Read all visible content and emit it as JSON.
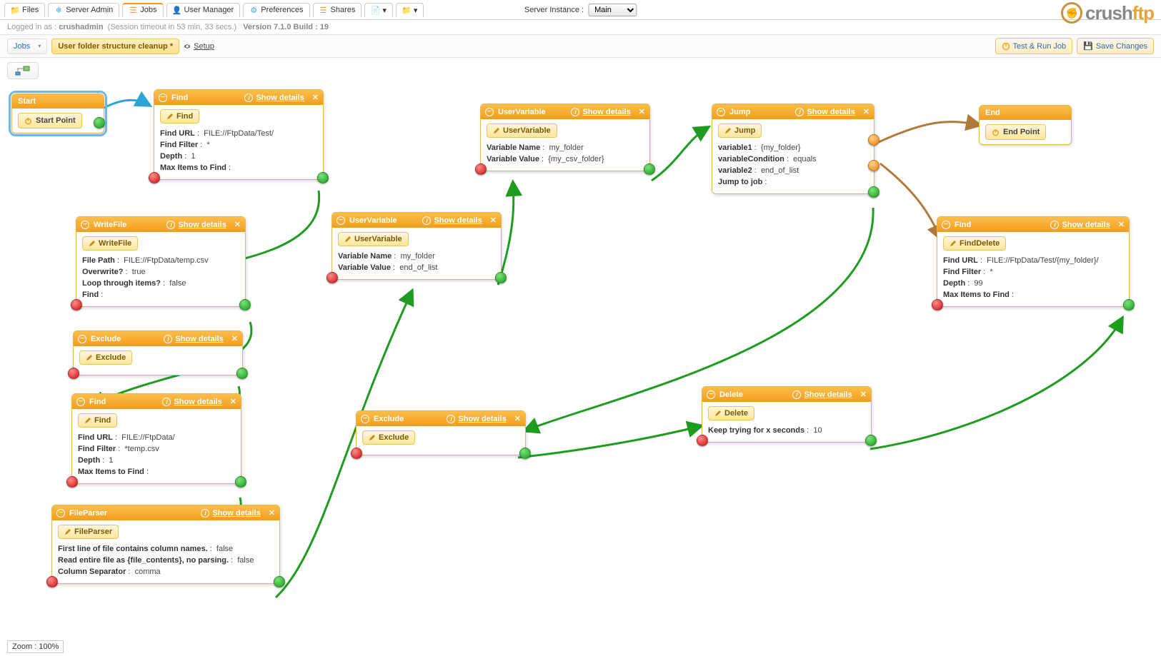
{
  "tabs": [
    {
      "label": "Files",
      "icon": "folder"
    },
    {
      "label": "Server Admin",
      "icon": "server"
    },
    {
      "label": "Jobs",
      "icon": "jobs",
      "active": true
    },
    {
      "label": "User Manager",
      "icon": "user"
    },
    {
      "label": "Preferences",
      "icon": "prefs"
    },
    {
      "label": "Shares",
      "icon": "shares"
    }
  ],
  "server_instance": {
    "label": "Server Instance :",
    "value": "Main"
  },
  "login_info": {
    "prefix": "Logged in as :",
    "user": "crushadmin",
    "session": "(Session timeout in 53 min, 33 secs.)",
    "version": "Version 7.1.0 Build : 19"
  },
  "toolbar": {
    "jobs_label": "Jobs",
    "job_name": "User folder structure cleanup *",
    "setup": "Setup",
    "test_run": "Test & Run Job",
    "save": "Save Changes"
  },
  "zoom": {
    "label": "Zoom :",
    "value": "100%"
  },
  "logo": {
    "a": "crush",
    "b": "ftp"
  },
  "nodes": {
    "start": {
      "title": "Start",
      "btn": "Start Point"
    },
    "end": {
      "title": "End",
      "btn": "End Point"
    },
    "find1": {
      "title": "Find",
      "tag": "Find",
      "show": "Show details",
      "rows": [
        [
          "Find URL",
          "FILE://FtpData/Test/"
        ],
        [
          "Find Filter",
          "*"
        ],
        [
          "Depth",
          "1"
        ],
        [
          "Max Items to Find",
          ""
        ]
      ]
    },
    "uv_top": {
      "title": "UserVariable",
      "tag": "UserVariable",
      "show": "Show details",
      "rows": [
        [
          "Variable Name",
          "my_folder"
        ],
        [
          "Variable Value",
          "{my_csv_folder}"
        ]
      ]
    },
    "jump": {
      "title": "Jump",
      "tag": "Jump",
      "show": "Show details",
      "rows": [
        [
          "variable1",
          "{my_folder}"
        ],
        [
          "variableCondition",
          "equals"
        ],
        [
          "variable2",
          "end_of_list"
        ],
        [
          "Jump to job",
          ""
        ]
      ]
    },
    "find_right": {
      "title": "Find",
      "tag": "FindDelete",
      "show": "Show details",
      "rows": [
        [
          "Find URL",
          "FILE://FtpData/Test/{my_folder}/"
        ],
        [
          "Find Filter",
          "*"
        ],
        [
          "Depth",
          "99"
        ],
        [
          "Max Items to Find",
          ""
        ]
      ]
    },
    "writefile": {
      "title": "WriteFile",
      "tag": "WriteFile",
      "show": "Show details",
      "rows": [
        [
          "File Path",
          "FILE://FtpData/temp.csv"
        ],
        [
          "Overwrite?",
          "true"
        ],
        [
          "Loop through items?",
          "false"
        ],
        [
          "Find",
          ""
        ]
      ]
    },
    "uv_mid": {
      "title": "UserVariable",
      "tag": "UserVariable",
      "show": "Show details",
      "rows": [
        [
          "Variable Name",
          "my_folder"
        ],
        [
          "Variable Value",
          "end_of_list"
        ]
      ]
    },
    "exclude1": {
      "title": "Exclude",
      "tag": "Exclude",
      "show": "Show details",
      "rows": []
    },
    "find2": {
      "title": "Find",
      "tag": "Find",
      "show": "Show details",
      "rows": [
        [
          "Find URL",
          "FILE://FtpData/"
        ],
        [
          "Find Filter",
          "*temp.csv"
        ],
        [
          "Depth",
          "1"
        ],
        [
          "Max Items to Find",
          ""
        ]
      ]
    },
    "exclude2": {
      "title": "Exclude",
      "tag": "Exclude",
      "show": "Show details",
      "rows": []
    },
    "delete": {
      "title": "Delete",
      "tag": "Delete",
      "show": "Show details",
      "rows": [
        [
          "Keep trying for x seconds",
          "10"
        ]
      ]
    },
    "fileparser": {
      "title": "FileParser",
      "tag": "FileParser",
      "show": "Show details",
      "rows": [
        [
          "First line of file contains column names.",
          "false"
        ],
        [
          "Read entire file as {file_contents}, no parsing.",
          "false"
        ],
        [
          "Column Separator",
          "comma"
        ]
      ]
    }
  }
}
